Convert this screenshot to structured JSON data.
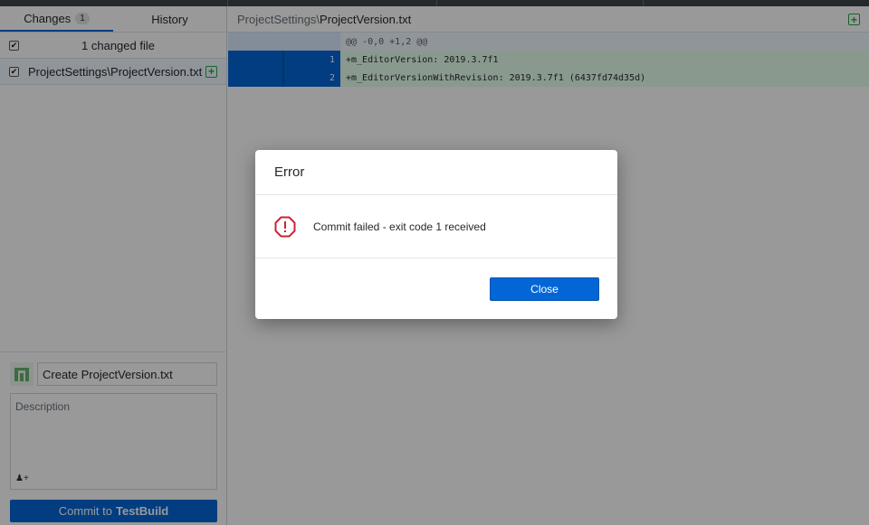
{
  "colors": {
    "accent": "#0366d6",
    "added": "#28a745",
    "error": "#cb2431"
  },
  "tabs": [
    {
      "label": "Changes",
      "count": "1"
    },
    {
      "label": "History"
    }
  ],
  "changes": {
    "summary": "1 changed file",
    "files": [
      {
        "path": "ProjectSettings\\ProjectVersion.txt",
        "status_icon": "plus-box-icon"
      }
    ]
  },
  "commit": {
    "summary_value": "Create ProjectVersion.txt",
    "description_placeholder": "Description",
    "coauthor_icon": "person-plus-icon",
    "button_prefix": "Commit to",
    "branch": "TestBuild"
  },
  "diff": {
    "path_dir": "ProjectSettings\\",
    "path_file": "ProjectVersion.txt",
    "hunk_header": "@@ -0,0 +1,2 @@",
    "lines": [
      {
        "new_ln": "1",
        "text": "+m_EditorVersion: 2019.3.7f1"
      },
      {
        "new_ln": "2",
        "text": "+m_EditorVersionWithRevision: 2019.3.7f1 (6437fd74d35d)"
      }
    ]
  },
  "dialog": {
    "title": "Error",
    "icon": "alert-octagon-icon",
    "message": "Commit failed - exit code 1 received",
    "close_label": "Close"
  }
}
